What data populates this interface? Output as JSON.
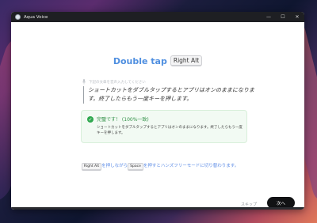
{
  "window": {
    "title": "Aqua Voice",
    "controls": {
      "minimize": "—",
      "maximize": "☐",
      "close": "✕"
    }
  },
  "headline": {
    "text": "Double tap",
    "key": "Right Alt"
  },
  "hint": {
    "text": "下記の文章を音声入力してください"
  },
  "prompt": {
    "text": "ショートカットをダブルタップするとアプリはオンのままになります。終了したらもう一度キーを押します。"
  },
  "result": {
    "title": "完璧です！ (100%一致)",
    "body": "ショートカットをダブルタップするとアプリはオンのままになります。終了したらもう一度キーを押します。"
  },
  "instruction": {
    "key1": "Right Alt",
    "text1": "を押しながら",
    "key2": "Space",
    "text2": "を押すとハンズフリーモードに切り替わります。"
  },
  "footer": {
    "skip": "スキップ",
    "next": "次へ"
  },
  "colors": {
    "accent": "#4f8fe0",
    "success": "#2fa84f",
    "primary_button": "#111214"
  },
  "icons": {
    "app": "aqua-voice-app-icon",
    "mic": "microphone-icon",
    "success": "check-circle-icon"
  }
}
